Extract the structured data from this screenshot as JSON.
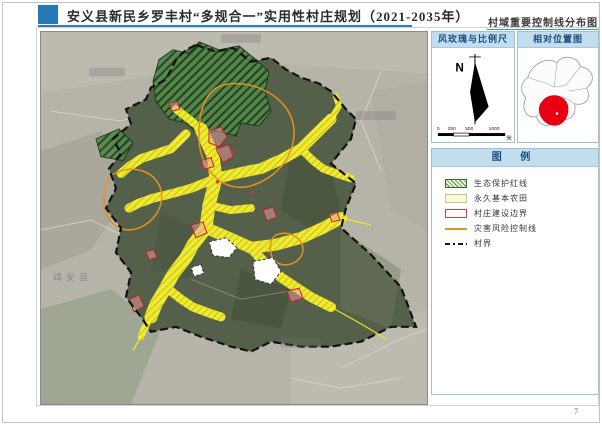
{
  "page": {
    "number": "7"
  },
  "header": {
    "title": "安义县新民乡罗丰村“多规合一”实用性村庄规划（2021-2035年）",
    "sheet_name": "村域重要控制线分布图",
    "accent_color": "#2679b8"
  },
  "map": {
    "county_label": "靖安县"
  },
  "compass_panel": {
    "title": "风玫瑰与比例尺",
    "north_label": "N",
    "scale_ticks": [
      "0",
      "250",
      "500",
      "1000"
    ],
    "scale_unit": "米"
  },
  "location_panel": {
    "title": "相对位置图",
    "highlight_color": "#e60012"
  },
  "legend_panel": {
    "title": "图 例",
    "items": [
      {
        "label": "生态保护红线",
        "swatch": "green-hatch"
      },
      {
        "label": "永久基本农田",
        "swatch": "yellow-fill"
      },
      {
        "label": "村庄建设边界",
        "swatch": "red-outline"
      },
      {
        "label": "灾害风险控制线",
        "swatch": "orange-line"
      },
      {
        "label": "村界",
        "swatch": "dash-dot-line"
      }
    ]
  }
}
